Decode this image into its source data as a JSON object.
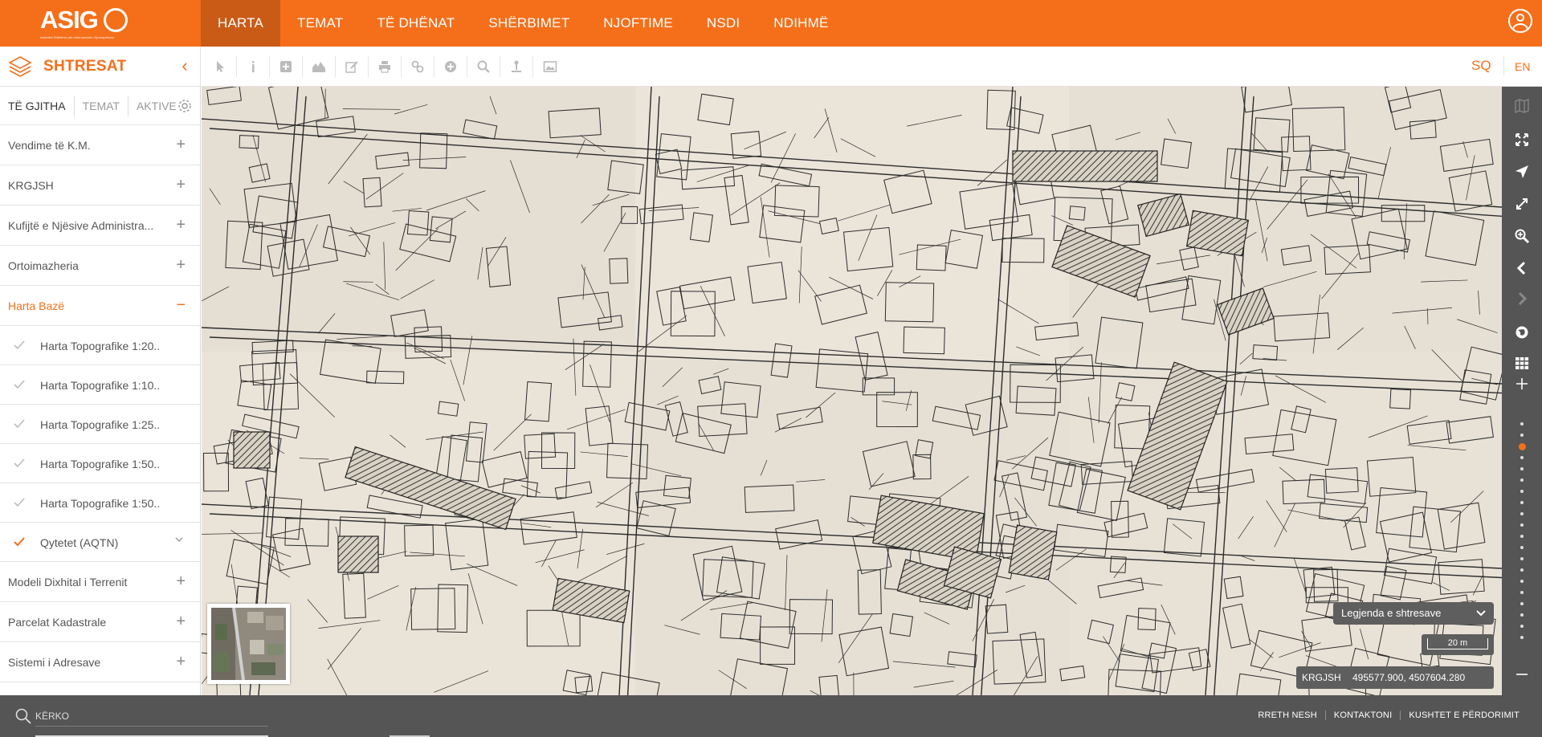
{
  "brand": {
    "logo_text": "ASIG",
    "logo_subtitle": "Autoriteti Shtetëror për Informacionin Gjeohapësinor",
    "accent_color": "#f56f1b"
  },
  "nav": {
    "items": [
      {
        "label": "HARTA",
        "active": true
      },
      {
        "label": "TEMAT"
      },
      {
        "label": "TË DHËNAT"
      },
      {
        "label": "SHËRBIMET"
      },
      {
        "label": "NJOFTIME"
      },
      {
        "label": "NSDI"
      },
      {
        "label": "NDIHMË"
      }
    ],
    "user_icon": "user-icon"
  },
  "toolbar": {
    "layers_title": "SHTRESAT",
    "collapse_icon": "chevron-left-icon",
    "tools": [
      "pointer-icon",
      "info-icon",
      "add-box-icon",
      "elevation-icon",
      "edit-icon",
      "print-icon",
      "link-icon",
      "add-circle-icon",
      "search-icon",
      "geolocate-icon",
      "image-icon"
    ],
    "lang_sq": "SQ",
    "lang_en": "EN"
  },
  "sidebar": {
    "tabs": [
      {
        "label": "TË GJITHA",
        "active": true
      },
      {
        "label": "TEMAT"
      },
      {
        "label": "AKTIVE"
      }
    ],
    "groups": [
      {
        "label": "Vendime të K.M.",
        "toggle": "+"
      },
      {
        "label": "KRGJSH",
        "toggle": "+"
      },
      {
        "label": "Kufijtë e Njësive Administra...",
        "toggle": "+"
      },
      {
        "label": "Ortoimazheria",
        "toggle": "+"
      },
      {
        "label": "Harta Bazë",
        "toggle": "−",
        "open": true
      }
    ],
    "sublayers": [
      {
        "label": "Harta Topografike 1:20...",
        "checked": false
      },
      {
        "label": "Harta Topografike 1:10...",
        "checked": false
      },
      {
        "label": "Harta Topografike 1:25...",
        "checked": false
      },
      {
        "label": "Harta Topografike 1:50...",
        "checked": false
      },
      {
        "label": "Harta Topografike 1:50...",
        "checked": false
      },
      {
        "label": "Qytetet (AQTN)",
        "checked": true
      }
    ],
    "groups_after": [
      {
        "label": "Modeli Dixhital i Terrenit",
        "toggle": "+"
      },
      {
        "label": "Parcelat Kadastrale",
        "toggle": "+"
      },
      {
        "label": "Sistemi i Adresave",
        "toggle": "+"
      }
    ]
  },
  "map": {
    "legend_label": "Legjenda e shtresave",
    "scale_label": "20 m",
    "crs": "KRGJSH",
    "coordinates": "495577.900, 4507604.280",
    "paper_color": "#e7e1d5",
    "ink_color": "#2c2c2c"
  },
  "rail": {
    "buttons": [
      "basemap-icon",
      "fullscreen-icon",
      "navigate-icon",
      "extent-icon",
      "zoom-box-icon",
      "back-icon",
      "forward-icon",
      "globe-icon",
      "grid-icon",
      "zoom-in-icon",
      "zoom-out-icon"
    ]
  },
  "bottom": {
    "search_placeholder": "KËRKO",
    "links": [
      "RRETH NESH",
      "KONTAKTONI",
      "KUSHTET E PËRDORIMIT"
    ]
  }
}
